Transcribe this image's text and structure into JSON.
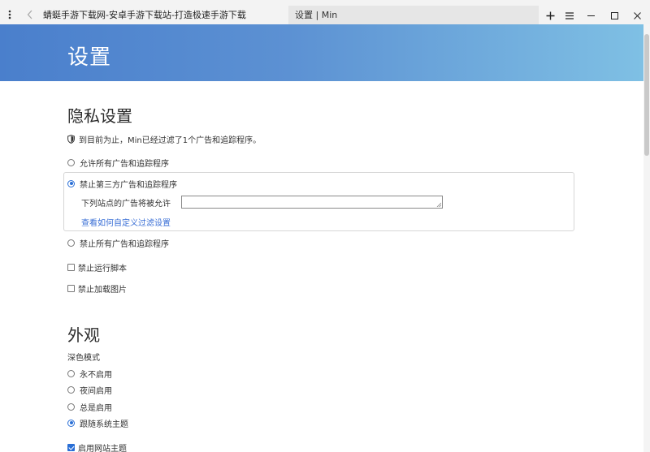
{
  "titlebar": {
    "menu_icon": "vertical-dots-icon",
    "back_icon": "chevron-left-icon",
    "tabs": [
      {
        "label": "蜻蜓手游下载网-安卓手游下载站-打造极速手游下载",
        "active": false
      },
      {
        "label": "设置 | Min",
        "active": true
      }
    ],
    "buttons": [
      "plus-icon",
      "hamburger-icon",
      "minimize-icon",
      "maximize-icon",
      "close-icon"
    ]
  },
  "banner": {
    "title": "设置"
  },
  "privacy": {
    "heading": "隐私设置",
    "blocked_notice": "到目前为止，Min已经过滤了1个广告和追踪程序。",
    "options": [
      {
        "label": "允许所有广告和追踪程序",
        "selected": false
      },
      {
        "label": "禁止第三方广告和追踪程序",
        "selected": true
      },
      {
        "label": "禁止所有广告和追踪程序",
        "selected": false
      }
    ],
    "allowed_sites_label": "下列站点的广告将被允许",
    "allowed_sites_value": "",
    "filter_link": "查看如何自定义过滤设置",
    "block_scripts_label": "禁止运行脚本",
    "block_scripts_checked": false,
    "block_images_label": "禁止加载图片",
    "block_images_checked": false
  },
  "appearance": {
    "heading": "外观",
    "dark_mode_label": "深色模式",
    "dark_mode_options": [
      {
        "label": "永不启用",
        "selected": false
      },
      {
        "label": "夜间启用",
        "selected": false
      },
      {
        "label": "总是启用",
        "selected": false
      },
      {
        "label": "跟随系统主题",
        "selected": true
      }
    ],
    "site_theme_label": "启用网站主题",
    "site_theme_checked": true
  },
  "colors": {
    "accent": "#2a6fd6",
    "link": "#3a6fd6",
    "banner_start": "#4a7fcc",
    "banner_end": "#7fc0e4"
  }
}
